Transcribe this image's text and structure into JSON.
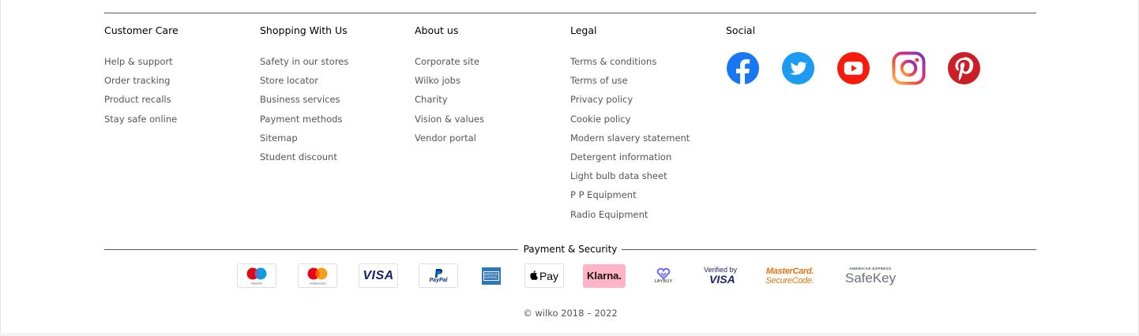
{
  "columns": [
    {
      "title": "Customer Care",
      "links": [
        "Help & support",
        "Order tracking",
        "Product recalls",
        "Stay safe online"
      ]
    },
    {
      "title": "Shopping With Us",
      "links": [
        "Safety in our stores",
        "Store locator",
        "Business services",
        "Payment methods",
        "Sitemap",
        "Student discount"
      ]
    },
    {
      "title": "About us",
      "links": [
        "Corporate site",
        "Wilko jobs",
        "Charity",
        "Vision & values",
        "Vendor portal"
      ]
    },
    {
      "title": "Legal",
      "links": [
        "Terms & conditions",
        "Terms of use",
        "Privacy policy",
        "Cookie policy",
        "Modern slavery statement",
        "Detergent information",
        "Light bulb data sheet",
        "P P Equipment",
        "Radio Equipment"
      ]
    }
  ],
  "social": {
    "title": "Social",
    "icons": [
      "facebook-icon",
      "twitter-icon",
      "youtube-icon",
      "instagram-icon",
      "pinterest-icon"
    ]
  },
  "payment": {
    "title": "Payment & Security",
    "badges": {
      "maestro": "maestro",
      "mastercard": "mastercard",
      "visa": "VISA",
      "paypal": "PayPal",
      "amex": "AMERICAN EXPRESS",
      "applepay": "Pay",
      "klarna": "Klarna.",
      "laybuy": "LAYBUY",
      "verified_by": "Verified by",
      "verified_visa": "VISA",
      "securecode_line1": "MasterCard.",
      "securecode_line2": "SecureCode.",
      "safekey_top": "AMERICAN EXPRESS",
      "safekey": "SafeKey"
    }
  },
  "copyright": "© wilko 2018 – 2022",
  "colors": {
    "facebook": "#1877f2",
    "twitter": "#1d9bf0",
    "youtube": "#f61c0d",
    "pinterest": "#cb1f27",
    "klarna": "#ffb3c7",
    "visa": "#1a1f71",
    "securecode": "#e8730c"
  }
}
